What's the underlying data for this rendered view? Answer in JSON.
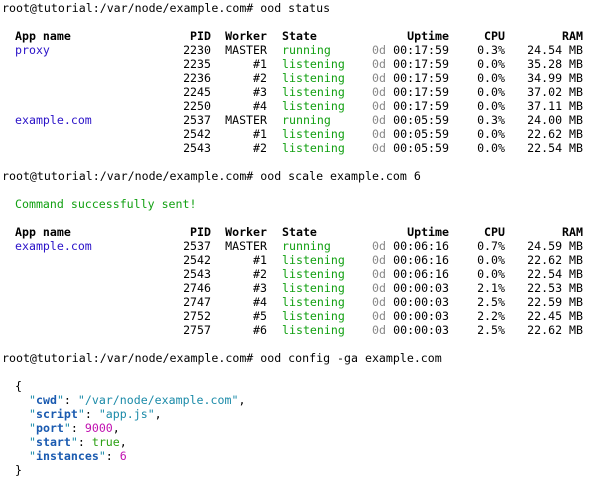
{
  "commands": [
    "root@tutorial:/var/node/example.com# ood status",
    "root@tutorial:/var/node/example.com# ood scale example.com 6",
    "root@tutorial:/var/node/example.com# ood config -ga example.com"
  ],
  "headers": {
    "app": "App name",
    "pid": "PID",
    "worker": "Worker",
    "state": "State",
    "uptime": "Uptime",
    "cpu": "CPU",
    "ram": "RAM"
  },
  "status_table": [
    {
      "app": "proxy",
      "pid": "2230",
      "worker": "MASTER",
      "state": "running",
      "days": "0d",
      "time": "00:17:59",
      "cpu": "0.3%",
      "ram": "24.54 MB"
    },
    {
      "app": "",
      "pid": "2235",
      "worker": "#1",
      "state": "listening",
      "days": "0d",
      "time": "00:17:59",
      "cpu": "0.0%",
      "ram": "35.28 MB"
    },
    {
      "app": "",
      "pid": "2236",
      "worker": "#2",
      "state": "listening",
      "days": "0d",
      "time": "00:17:59",
      "cpu": "0.0%",
      "ram": "34.99 MB"
    },
    {
      "app": "",
      "pid": "2245",
      "worker": "#3",
      "state": "listening",
      "days": "0d",
      "time": "00:17:59",
      "cpu": "0.0%",
      "ram": "37.02 MB"
    },
    {
      "app": "",
      "pid": "2250",
      "worker": "#4",
      "state": "listening",
      "days": "0d",
      "time": "00:17:59",
      "cpu": "0.0%",
      "ram": "37.11 MB"
    },
    {
      "app": "example.com",
      "pid": "2537",
      "worker": "MASTER",
      "state": "running",
      "days": "0d",
      "time": "00:05:59",
      "cpu": "0.3%",
      "ram": "24.00 MB"
    },
    {
      "app": "",
      "pid": "2542",
      "worker": "#1",
      "state": "listening",
      "days": "0d",
      "time": "00:05:59",
      "cpu": "0.0%",
      "ram": "22.62 MB"
    },
    {
      "app": "",
      "pid": "2543",
      "worker": "#2",
      "state": "listening",
      "days": "0d",
      "time": "00:05:59",
      "cpu": "0.0%",
      "ram": "22.54 MB"
    }
  ],
  "scale_message": "Command successfully sent!",
  "scaled_table": [
    {
      "app": "example.com",
      "pid": "2537",
      "worker": "MASTER",
      "state": "running",
      "days": "0d",
      "time": "00:06:16",
      "cpu": "0.7%",
      "ram": "24.59 MB"
    },
    {
      "app": "",
      "pid": "2542",
      "worker": "#1",
      "state": "listening",
      "days": "0d",
      "time": "00:06:16",
      "cpu": "0.0%",
      "ram": "22.62 MB"
    },
    {
      "app": "",
      "pid": "2543",
      "worker": "#2",
      "state": "listening",
      "days": "0d",
      "time": "00:06:16",
      "cpu": "0.0%",
      "ram": "22.54 MB"
    },
    {
      "app": "",
      "pid": "2746",
      "worker": "#3",
      "state": "listening",
      "days": "0d",
      "time": "00:00:03",
      "cpu": "2.1%",
      "ram": "22.53 MB"
    },
    {
      "app": "",
      "pid": "2747",
      "worker": "#4",
      "state": "listening",
      "days": "0d",
      "time": "00:00:03",
      "cpu": "2.5%",
      "ram": "22.59 MB"
    },
    {
      "app": "",
      "pid": "2752",
      "worker": "#5",
      "state": "listening",
      "days": "0d",
      "time": "00:00:03",
      "cpu": "2.2%",
      "ram": "22.45 MB"
    },
    {
      "app": "",
      "pid": "2757",
      "worker": "#6",
      "state": "listening",
      "days": "0d",
      "time": "00:00:03",
      "cpu": "2.5%",
      "ram": "22.62 MB"
    }
  ],
  "config": [
    {
      "key": "cwd",
      "value": "\"/var/node/example.com\"",
      "type": "s",
      "comma": ","
    },
    {
      "key": "script",
      "value": "\"app.js\"",
      "type": "s",
      "comma": ","
    },
    {
      "key": "port",
      "value": "9000",
      "type": "n",
      "comma": ","
    },
    {
      "key": "start",
      "value": "true",
      "type": "b",
      "comma": ","
    },
    {
      "key": "instances",
      "value": "6",
      "type": "n",
      "comma": ""
    }
  ],
  "brace_open": "{",
  "brace_close": "}"
}
